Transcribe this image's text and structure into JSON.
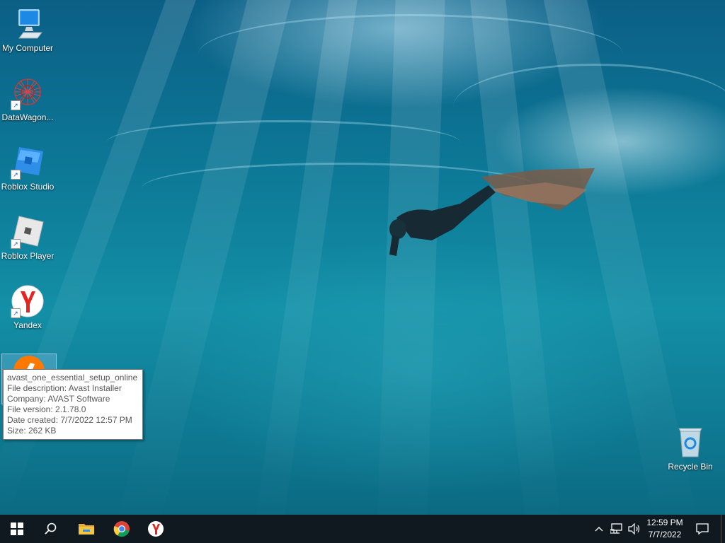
{
  "desktop": {
    "icons": [
      {
        "label": "My Computer",
        "icon": "monitor-icon"
      },
      {
        "label": "DataWagon...",
        "icon": "network-sphere-icon"
      },
      {
        "label": "Roblox Studio",
        "icon": "roblox-studio-icon"
      },
      {
        "label": "Roblox Player",
        "icon": "roblox-player-icon"
      },
      {
        "label": "Yandex",
        "icon": "yandex-icon"
      },
      {
        "label": "",
        "icon": "avast-icon"
      },
      {
        "label": "Recycle Bin",
        "icon": "recycle-bin-icon"
      }
    ]
  },
  "tooltip": {
    "name": "avast_one_essential_setup_online",
    "description": "File description: Avast Installer",
    "company": "Company: AVAST Software",
    "version": "File version: 2.1.78.0",
    "date": "Date created: 7/7/2022 12:57 PM",
    "size": "Size: 262 KB"
  },
  "taskbar": {
    "items": [
      "windows-start-icon",
      "search-icon",
      "file-explorer-icon",
      "chrome-icon",
      "yandex-icon"
    ],
    "tray": {
      "time": "12:59 PM",
      "date": "7/7/2022",
      "icons": [
        "chevron-up-icon",
        "network-icon",
        "volume-icon",
        "notification-icon"
      ]
    }
  },
  "colors": {
    "taskbar": "#101820",
    "yandex_red": "#e52620",
    "avast_orange": "#ff7800",
    "folder_yellow": "#f4c542"
  }
}
